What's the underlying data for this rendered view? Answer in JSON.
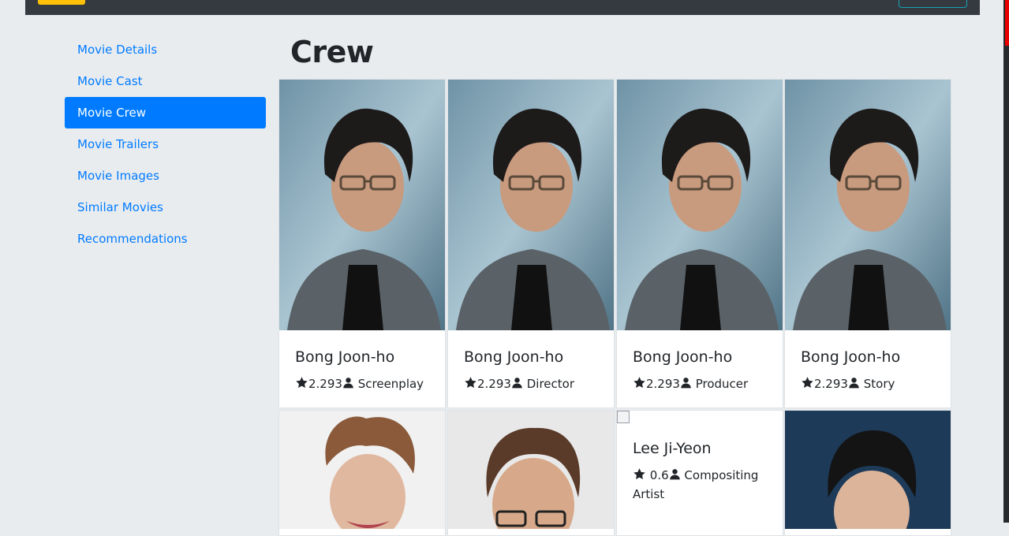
{
  "sidebar": {
    "items": [
      {
        "label": "Movie Details"
      },
      {
        "label": "Movie Cast"
      },
      {
        "label": "Movie Crew",
        "active": true
      },
      {
        "label": "Movie Trailers"
      },
      {
        "label": "Movie Images"
      },
      {
        "label": "Similar Movies"
      },
      {
        "label": "Recommendations"
      }
    ]
  },
  "main": {
    "title": "Crew",
    "crew": [
      {
        "name": "Bong Joon-ho",
        "rating": "2.293",
        "job": "Screenplay"
      },
      {
        "name": "Bong Joon-ho",
        "rating": "2.293",
        "job": "Director"
      },
      {
        "name": "Bong Joon-ho",
        "rating": "2.293",
        "job": "Producer"
      },
      {
        "name": "Bong Joon-ho",
        "rating": "2.293",
        "job": "Story"
      },
      {
        "name": "",
        "rating": "",
        "job": ""
      },
      {
        "name": "",
        "rating": "",
        "job": ""
      },
      {
        "name": "Lee Ji-Yeon",
        "rating": "0.6",
        "job": "Compositing Artist"
      },
      {
        "name": "",
        "rating": "",
        "job": ""
      }
    ]
  },
  "colors": {
    "accent": "#007bff",
    "navbar": "#343a40",
    "page_bg": "#e9ecef"
  }
}
